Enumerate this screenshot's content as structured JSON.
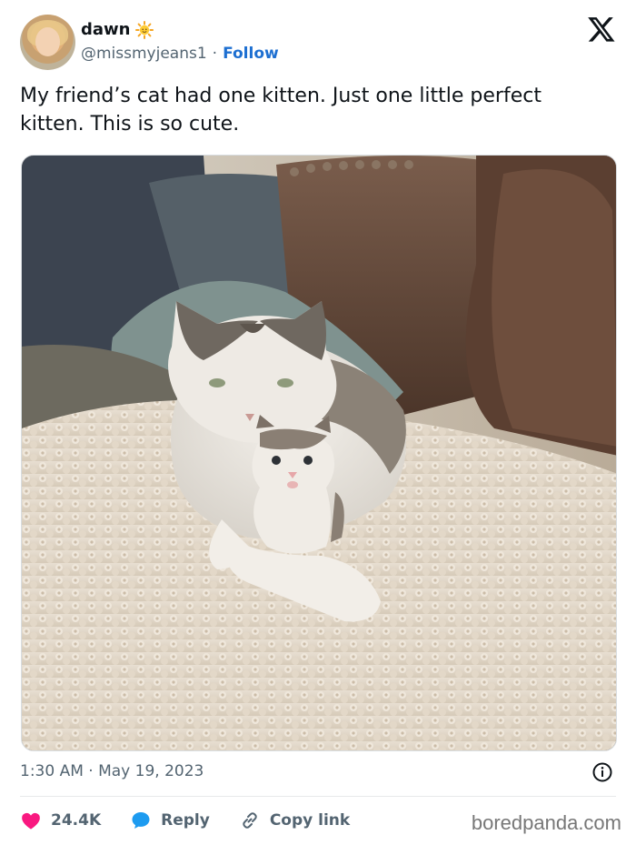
{
  "author": {
    "name": "dawn",
    "handle": "@missmyjeans1",
    "separator": "·",
    "follow_label": "Follow",
    "badge_icon": "sun-emoji-icon"
  },
  "platform_icon": "x-logo-icon",
  "tweet": {
    "text": "My friend’s cat had one kitten. Just one little perfect kitten. This is so cute."
  },
  "photo": {
    "icon": "photo-cat-with-kitten"
  },
  "meta": {
    "timestamp": "1:30 AM · May 19, 2023",
    "info_icon": "info-icon"
  },
  "actions": {
    "likes": "24.4K",
    "reply_label": "Reply",
    "copy_label": "Copy link"
  },
  "credit": "boredpanda.com",
  "colors": {
    "follow": "#1d6fd1",
    "like": "#f91880",
    "reply": "#1d9bf0",
    "muted": "#536471"
  }
}
